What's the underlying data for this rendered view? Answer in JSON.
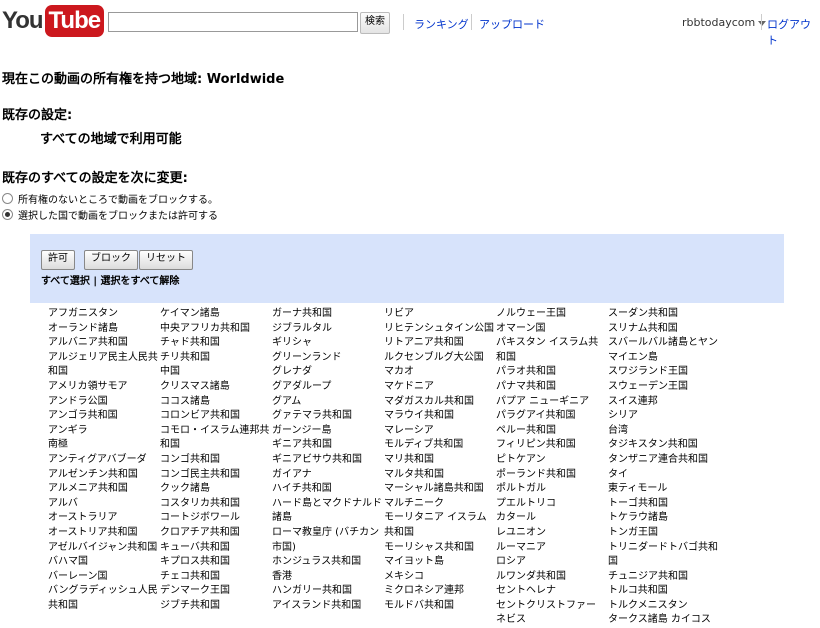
{
  "header": {
    "logo_you": "You",
    "logo_tube": "Tube",
    "search_value": "",
    "search_button": "検索",
    "ranking": "ランキング",
    "upload": "アップロード",
    "username": "rbbtodaycom",
    "logout": "ログアウト"
  },
  "content": {
    "owner_heading": "現在この動画の所有権を持つ地域: Worldwide",
    "existing_heading": "既存の設定:",
    "existing_value": "すべての地域で利用可能",
    "change_heading": "既存のすべての設定を次に変更:",
    "radio_block_unowned": "所有権のないところで動画をブロックする。",
    "radio_block_selected": "選択した国で動画をブロックまたは許可する"
  },
  "panel": {
    "allow": "許可",
    "block": "ブロック",
    "reset": "リセット",
    "select_all": "すべて選択",
    "divider": " | ",
    "deselect_all": "選択をすべて解除"
  },
  "countries": [
    [
      "アフガニスタン",
      "オーランド諸島",
      "アルバニア共和国",
      "アルジェリア民主人民共和国",
      "アメリカ領サモア",
      "アンドラ公国",
      "アンゴラ共和国",
      "アンギラ",
      "南極",
      "アンティグアバブーダ",
      "アルゼンチン共和国",
      "アルメニア共和国",
      "アルバ",
      "オーストラリア",
      "オーストリア共和国",
      "アゼルバイジャン共和国",
      "バハマ国",
      "バーレーン国",
      "バングラディッシュ人民共和国"
    ],
    [
      "ケイマン諸島",
      "中央アフリカ共和国",
      "チャド共和国",
      "チリ共和国",
      "中国",
      "クリスマス諸島",
      "ココス諸島",
      "コロンビア共和国",
      "コモロ・イスラム連邦共和国",
      "コンゴ共和国",
      "コンゴ民主共和国",
      "クック諸島",
      "コスタリカ共和国",
      "コートジボワール",
      "クロアチア共和国",
      "キューバ共和国",
      "キプロス共和国",
      "チェコ共和国",
      "デンマーク王国",
      "ジブチ共和国"
    ],
    [
      "ガーナ共和国",
      "ジブラルタル",
      "ギリシャ",
      "グリーンランド",
      "グレナダ",
      "グアダループ",
      "グアム",
      "グァテマラ共和国",
      "ガーンジー島",
      "ギニア共和国",
      "ギニアビサウ共和国",
      "ガイアナ",
      "ハイチ共和国",
      "ハード島とマクドナルド諸島",
      "ローマ教皇庁 (バチカン市国)",
      "ホンジュラス共和国",
      "香港",
      "ハンガリー共和国",
      "アイスランド共和国"
    ],
    [
      "リビア",
      "リヒテンシュタイン公国",
      "リトアニア共和国",
      "ルクセンブルグ大公国",
      "マカオ",
      "マケドニア",
      "マダガスカル共和国",
      "マラウイ共和国",
      "マレーシア",
      "モルディブ共和国",
      "マリ共和国",
      "マルタ共和国",
      "マーシャル諸島共和国",
      "マルチニーク",
      "モーリタニア イスラム共和国",
      "モーリシャス共和国",
      "マイヨット島",
      "メキシコ",
      "ミクロネシア連邦",
      "モルドバ共和国"
    ],
    [
      "ノルウェー王国",
      "オマーン国",
      "パキスタン イスラム共和国",
      "パラオ共和国",
      "パナマ共和国",
      "パプア ニューギニア",
      "パラグアイ共和国",
      "ペルー共和国",
      "フィリピン共和国",
      "ピトケアン",
      "ポーランド共和国",
      "ポルトガル",
      "プエルトリコ",
      "カタール",
      "レユニオン",
      "ルーマニア",
      "ロシア",
      "ルワンダ共和国",
      "セントヘレナ",
      "セントクリストファー ネビス"
    ],
    [
      "スーダン共和国",
      "スリナム共和国",
      "スバールバル諸島とヤンマイエン島",
      "スワジランド王国",
      "スウェーデン王国",
      "スイス連邦",
      "シリア",
      "台湾",
      "タジキスタン共和国",
      "タンザニア連合共和国",
      "タイ",
      "東ティモール",
      "トーゴ共和国",
      "トケラウ諸島",
      "トンガ王国",
      "トリニダードトバゴ共和国",
      "チュニジア共和国",
      "トルコ共和国",
      "トルクメニスタン",
      "タークス諸島 カイコス"
    ]
  ]
}
